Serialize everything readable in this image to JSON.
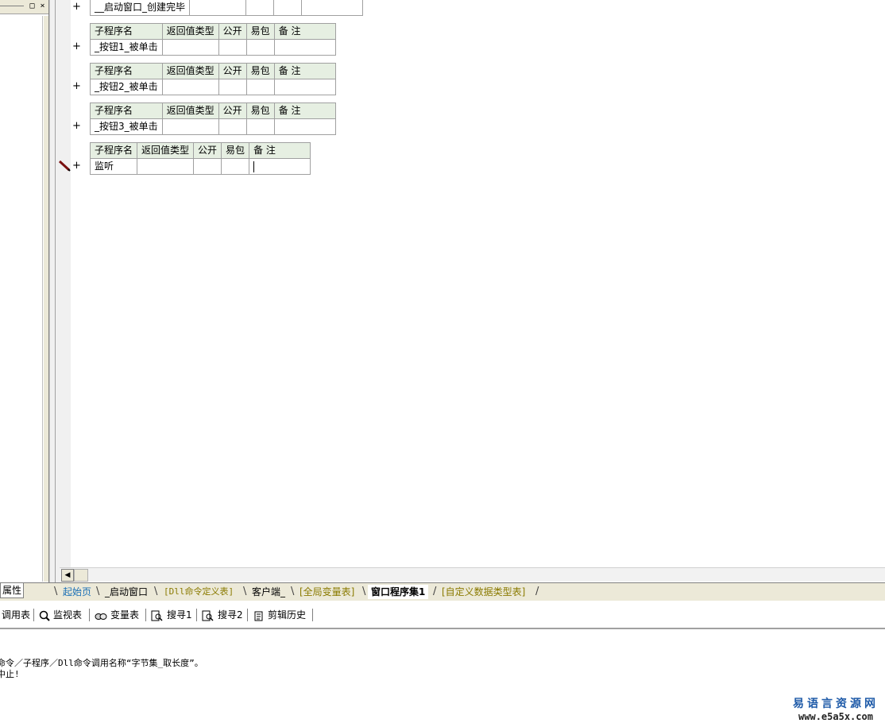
{
  "window": {
    "left_pane_buttons": [
      "□",
      "×"
    ],
    "property_tab": "属性"
  },
  "editor": {
    "first_row": {
      "name": "__启动窗口_创建完毕"
    },
    "tables": [
      {
        "headers": [
          "子程序名",
          "返回值类型",
          "公开",
          "易包",
          "备 注"
        ],
        "row": [
          "_按钮1_被单击",
          "",
          "",
          "",
          ""
        ]
      },
      {
        "headers": [
          "子程序名",
          "返回值类型",
          "公开",
          "易包",
          "备 注"
        ],
        "row": [
          "_按钮2_被单击",
          "",
          "",
          "",
          ""
        ]
      },
      {
        "headers": [
          "子程序名",
          "返回值类型",
          "公开",
          "易包",
          "备 注"
        ],
        "row": [
          "_按钮3_被单击",
          "",
          "",
          "",
          ""
        ]
      },
      {
        "headers": [
          "子程序名",
          "返回值类型",
          "公开",
          "易包",
          "备 注"
        ],
        "row": [
          "监听",
          "",
          "",
          "",
          ""
        ]
      }
    ],
    "expand_glyph": "+"
  },
  "tabs": [
    {
      "label": "起始页",
      "color": "#1a6fb5"
    },
    {
      "label": "_启动窗口",
      "color": "#000000"
    },
    {
      "label": "[Dll命令定义表]",
      "color": "#8a7a00"
    },
    {
      "label": "客户端_",
      "color": "#000000"
    },
    {
      "label": "[全局变量表]",
      "color": "#8a7a00"
    },
    {
      "label": "窗口程序集1",
      "color": "#000000",
      "active": true
    },
    {
      "label": "[自定义数据类型表]",
      "color": "#8a7a00"
    }
  ],
  "toolbar": {
    "items": [
      {
        "label": "调用表",
        "icon": "call-table-icon"
      },
      {
        "label": "监视表",
        "icon": "magnifier-icon"
      },
      {
        "label": "变量表",
        "icon": "variables-icon"
      },
      {
        "label": "搜寻1",
        "icon": "search-doc-icon"
      },
      {
        "label": "搜寻2",
        "icon": "search-doc-icon"
      },
      {
        "label": "剪辑历史",
        "icon": "clipboard-icon"
      }
    ]
  },
  "output": {
    "lines": [
      "命令／子程序／Dll命令调用名称“字节集_取长度”。",
      "中止!"
    ]
  },
  "watermark": {
    "title": "易语言资源网",
    "url": "www.e5a5x.com"
  }
}
